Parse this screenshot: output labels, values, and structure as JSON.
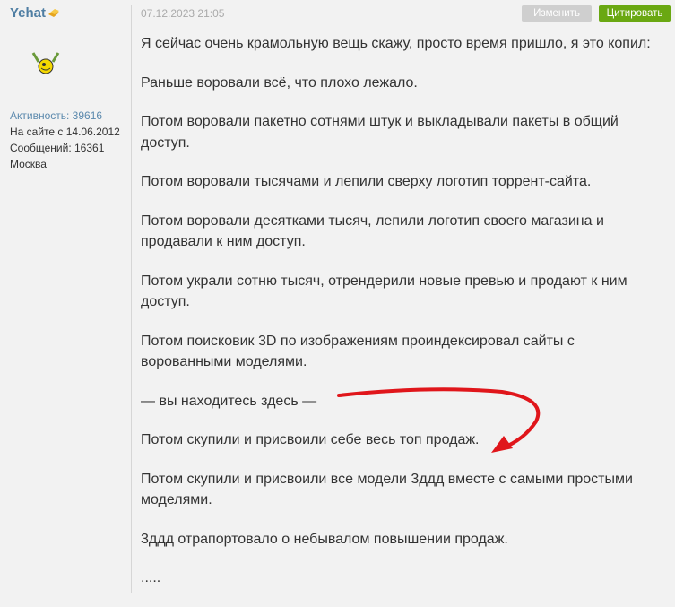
{
  "user": {
    "name": "Yehat",
    "activity": "Активность: 39616",
    "since": "На сайте с 14.06.2012",
    "messages": "Сообщений: 16361",
    "city": "Москва"
  },
  "post": {
    "date": "07.12.2023 21:05",
    "edit_label": "Изменить",
    "quote_label": "Цитировать",
    "paragraphs": [
      "Я сейчас очень крамольную вещь скажу, просто время пришло, я это копил:",
      "Раньше воровали всё, что плохо лежало.",
      "Потом воровали пакетно сотнями штук и выкладывали пакеты в общий доступ.",
      "Потом воровали тысячами и лепили сверху логотип торрент-сайта.",
      "Потом воровали десятками тысяч, лепили логотип своего магазина и продавали к ним доступ.",
      "Потом украли сотню тысяч, отрендерили новые превью и продают к ним доступ.",
      "Потом поисковик 3D по изображениям проиндексировал сайты с ворованными моделями.",
      "— вы находитесь здесь —",
      "Потом скупили и присвоили себе весь топ продаж.",
      "Потом скупили и присвоили все модели 3ддд вместе с самыми простыми моделями.",
      "3ддд отрапортовало о небывалом повышении продаж.",
      "....."
    ]
  },
  "colors": {
    "accent": "#6aa812",
    "link": "#4f7ea3",
    "arrow": "#e0161b"
  }
}
